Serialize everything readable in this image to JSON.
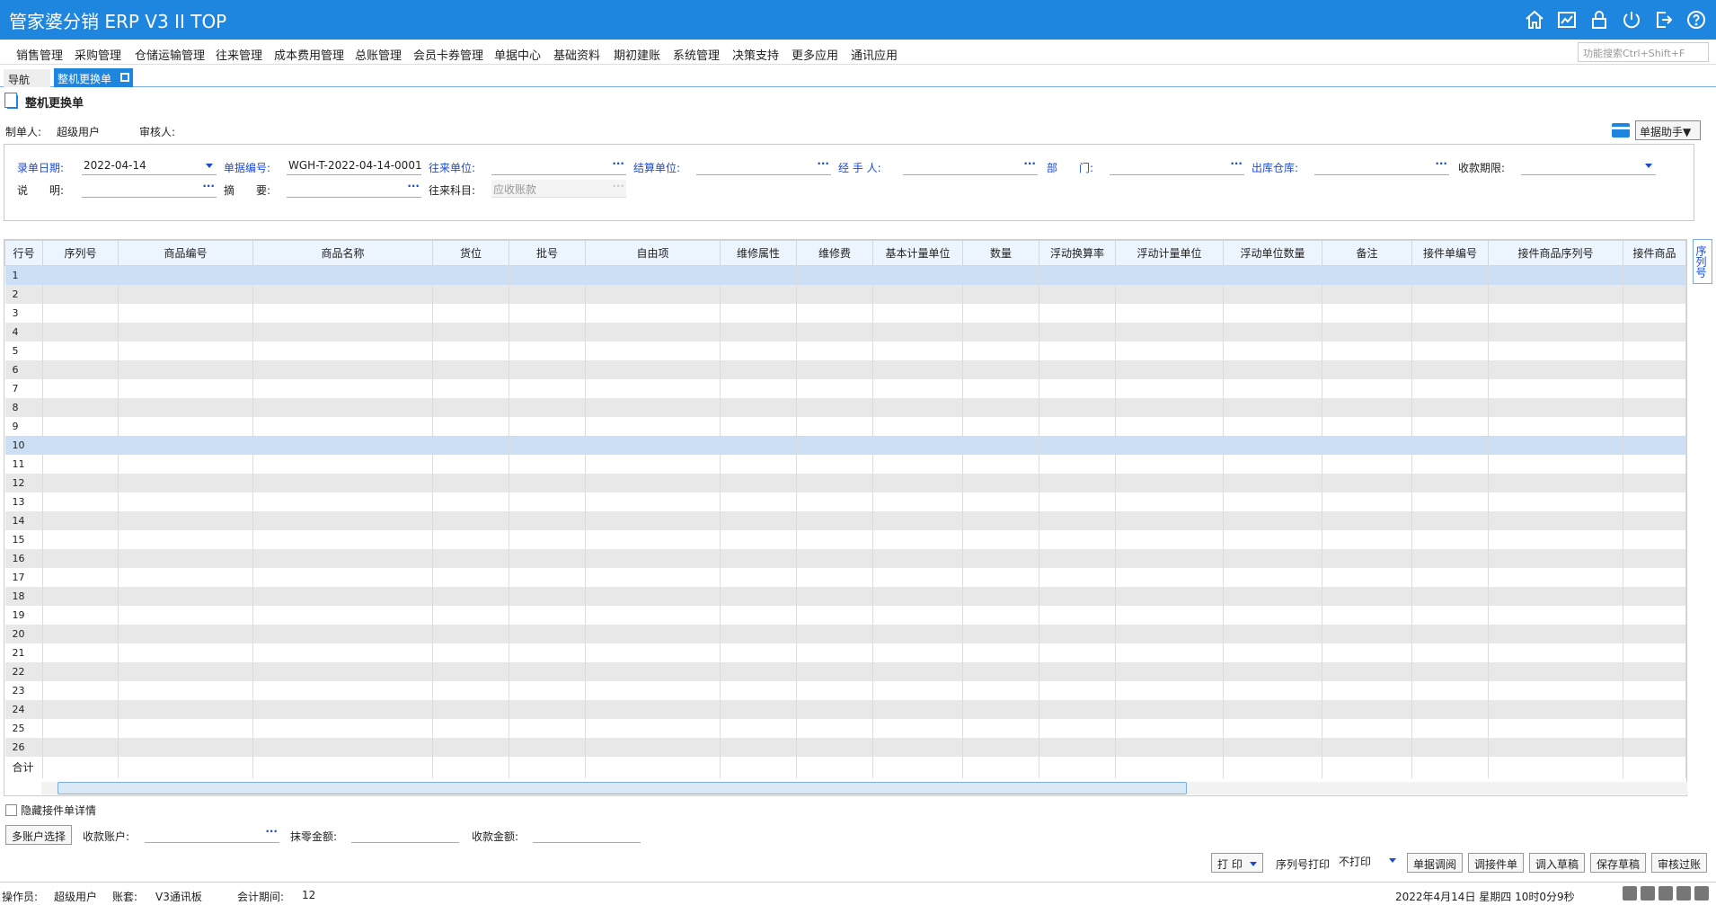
{
  "app": {
    "title": "管家婆分销 ERP V3 II TOP"
  },
  "titlebar_icons": [
    "home-icon",
    "chart-icon",
    "lock-icon",
    "power-icon",
    "exit-icon",
    "help-icon"
  ],
  "menu": [
    "销售管理",
    "采购管理",
    "仓储运输管理",
    "往来管理",
    "成本费用管理",
    "总账管理",
    "会员卡券管理",
    "单据中心",
    "基础资料",
    "期初建账",
    "系统管理",
    "决策支持",
    "更多应用",
    "通讯应用"
  ],
  "search": {
    "placeholder": "功能搜索Ctrl+Shift+F"
  },
  "tabs": {
    "nav": "导航",
    "active": "整机更换单"
  },
  "page": {
    "title": "整机更换单"
  },
  "info": {
    "maker_label": "制单人:",
    "maker_value": "超级用户",
    "auditor_label": "审核人:",
    "helper_button": "单据助手▼"
  },
  "form": {
    "date_label": "录单日期:",
    "date_value": "2022-04-14",
    "docno_label": "单据编号:",
    "docno_value": "WGH-T-2022-04-14-0001",
    "partner_label": "往来单位:",
    "partner_value": "",
    "settle_label": "结算单位:",
    "settle_value": "",
    "handler_label": "经 手 人:",
    "handler_value": "",
    "dept_label": "部　　门:",
    "dept_value": "",
    "warehouse_label": "出库仓库:",
    "warehouse_value": "",
    "term_label": "收款期限:",
    "term_value": "",
    "desc_label": "说　　明:",
    "desc_value": "",
    "summary_label": "摘　　要:",
    "summary_value": "",
    "account_label": "往来科目:",
    "account_value": "应收账款"
  },
  "grid": {
    "columns": [
      "行号",
      "序列号",
      "商品编号",
      "商品名称",
      "货位",
      "批号",
      "自由项",
      "维修属性",
      "维修费",
      "基本计量单位",
      "数量",
      "浮动换算率",
      "浮动计量单位",
      "浮动单位数量",
      "备注",
      "接件单编号",
      "接件商品序列号",
      "接件商品"
    ],
    "rows": [
      "1",
      "2",
      "3",
      "4",
      "5",
      "6",
      "7",
      "8",
      "9",
      "10",
      "11",
      "12",
      "13",
      "14",
      "15",
      "16",
      "17",
      "18",
      "19",
      "20",
      "21",
      "22",
      "23",
      "24",
      "25",
      "26"
    ],
    "total_label": "合计",
    "side_tab": "序列号"
  },
  "bottom": {
    "hide_detail": "隐藏接件单详情",
    "multi_account_btn": "多账户选择",
    "receipt_account_label": "收款账户:",
    "discount_label": "抹零金额:",
    "receipt_amount_label": "收款金额:",
    "print_btn": "打 印",
    "serial_print_label": "序列号打印",
    "serial_print_value": "不打印",
    "buttons": [
      "单据调阅",
      "调接件单",
      "调入草稿",
      "保存草稿",
      "审核过账"
    ]
  },
  "status": {
    "operator_label": "操作员:",
    "operator_value": "超级用户",
    "book_label": "账套:",
    "book_value": "V3通讯板",
    "period_label": "会计期间:",
    "period_value": "12",
    "datetime": "2022年4月14日  星期四  10时0分9秒"
  }
}
